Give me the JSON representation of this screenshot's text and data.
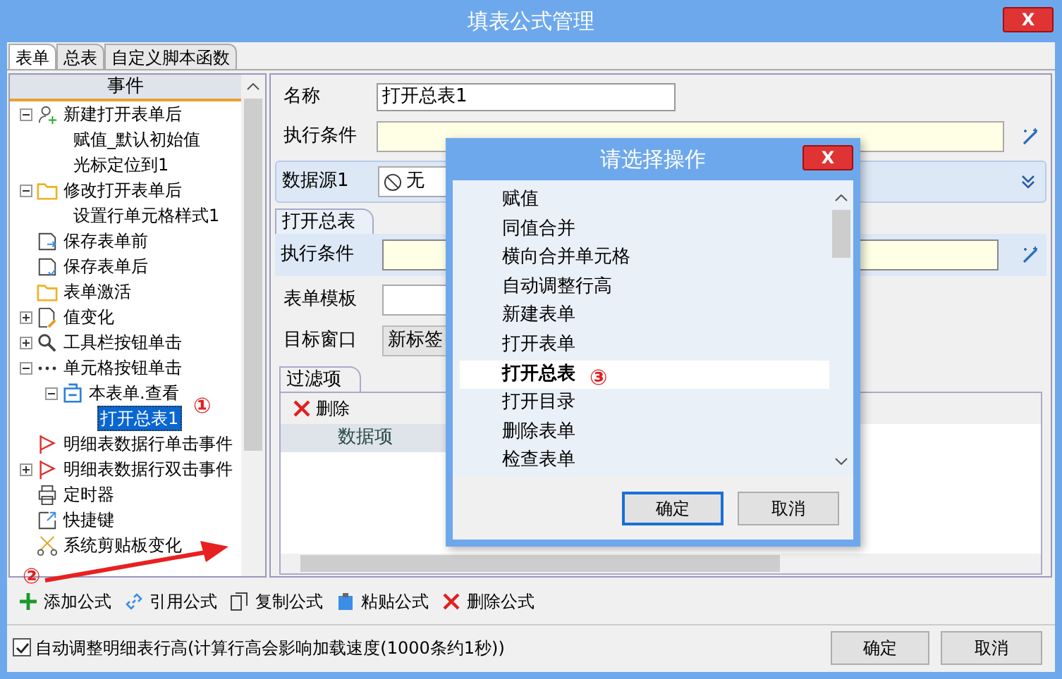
{
  "window": {
    "title": "填表公式管理"
  },
  "tabs": [
    {
      "label": "表单",
      "selected": true
    },
    {
      "label": "总表",
      "selected": false
    },
    {
      "label": "自定义脚本函数",
      "selected": false
    }
  ],
  "event_tree": {
    "header": "事件",
    "items": [
      {
        "label": "新建打开表单后",
        "kind": "user-add",
        "expanded": true,
        "selected": false,
        "children": [
          {
            "label": "赋值_默认初始值",
            "selected": false
          },
          {
            "label": "光标定位到1",
            "selected": false
          }
        ]
      },
      {
        "label": "修改打开表单后",
        "kind": "folder",
        "expanded": true,
        "selected": false,
        "children": [
          {
            "label": "设置行单元格样式1",
            "selected": false
          }
        ]
      },
      {
        "label": "保存表单前",
        "kind": "save-in",
        "selected": false
      },
      {
        "label": "保存表单后",
        "kind": "save-out",
        "selected": false
      },
      {
        "label": "表单激活",
        "kind": "folder",
        "selected": false
      },
      {
        "label": "值变化",
        "kind": "edit",
        "expanded": false,
        "selected": false
      },
      {
        "label": "工具栏按钮单击",
        "kind": "search",
        "expanded": false,
        "selected": false
      },
      {
        "label": "单元格按钮单击",
        "kind": "dots",
        "expanded": true,
        "selected": false,
        "children": [
          {
            "label": "本表单.查看",
            "kind": "form",
            "expanded": true,
            "selected": false,
            "children": [
              {
                "label": "打开总表1",
                "selected": true
              }
            ]
          }
        ]
      },
      {
        "label": "明细表数据行单击事件",
        "kind": "flag",
        "selected": false
      },
      {
        "label": "明细表数据行双击事件",
        "kind": "flag",
        "expanded": false,
        "selected": false
      },
      {
        "label": "定时器",
        "kind": "printer",
        "selected": false
      },
      {
        "label": "快捷键",
        "kind": "shortcut",
        "selected": false
      },
      {
        "label": "系统剪贴板变化",
        "kind": "scissors",
        "selected": false
      }
    ]
  },
  "formula": {
    "name_label": "名称",
    "name_value": "打开总表1",
    "condition_label": "执行条件",
    "datasource_label": "数据源1",
    "datasource_value": "无",
    "action_tab": "打开总表",
    "action_condition_label": "执行条件",
    "template_label": "表单模板",
    "target_label": "目标窗口",
    "target_value": "新标签",
    "filter_tab": "过滤项",
    "delete_label": "删除",
    "grid_column": "数据项"
  },
  "dialog": {
    "title": "请选择操作",
    "close": "X",
    "items": [
      {
        "label": "赋值",
        "selected": false
      },
      {
        "label": "同值合并",
        "selected": false
      },
      {
        "label": "横向合并单元格",
        "selected": false
      },
      {
        "label": "自动调整行高",
        "selected": false
      },
      {
        "label": "新建表单",
        "selected": false
      },
      {
        "label": "打开表单",
        "selected": false
      },
      {
        "label": "打开总表",
        "selected": true
      },
      {
        "label": "打开目录",
        "selected": false
      },
      {
        "label": "删除表单",
        "selected": false
      },
      {
        "label": "检查表单",
        "selected": false
      }
    ],
    "ok": "确定",
    "cancel": "取消"
  },
  "toolbar": [
    {
      "label": "添加公式",
      "kind": "add"
    },
    {
      "label": "引用公式",
      "kind": "link"
    },
    {
      "label": "复制公式",
      "kind": "copy"
    },
    {
      "label": "粘贴公式",
      "kind": "paste"
    },
    {
      "label": "删除公式",
      "kind": "delete"
    }
  ],
  "footer": {
    "auto_height_label": "自动调整明细表行高(计算行高会影响加载速度(1000条约1秒))",
    "auto_height_checked": true,
    "ok": "确定",
    "cancel": "取消"
  },
  "annotations": [
    "①",
    "②",
    "③"
  ],
  "close": "X"
}
